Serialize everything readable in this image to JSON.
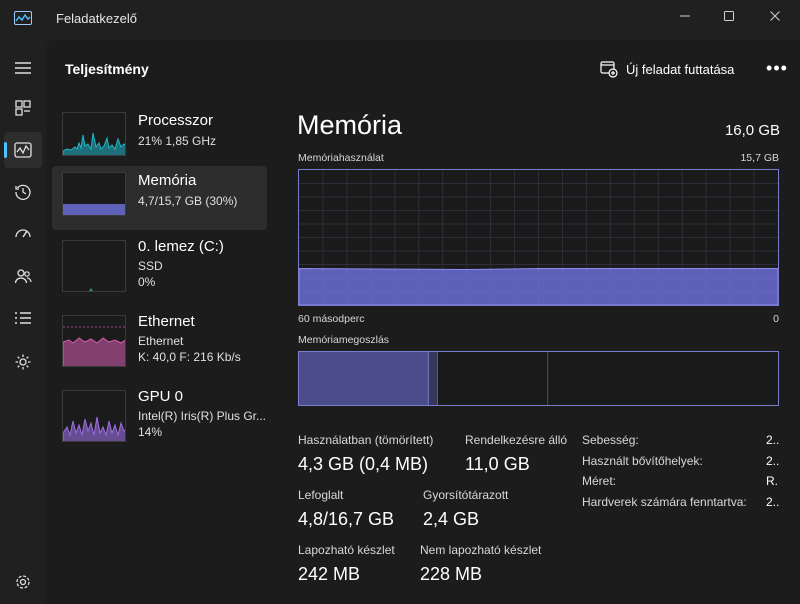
{
  "window": {
    "title": "Feladatkezelő",
    "minimize_glyph": "—",
    "maximize_glyph": "☐",
    "close_glyph": "✕"
  },
  "nav": {
    "items": [
      {
        "icon": "hamburger-menu-icon"
      },
      {
        "icon": "processes-icon"
      },
      {
        "icon": "performance-icon",
        "active": true
      },
      {
        "icon": "app-history-icon"
      },
      {
        "icon": "startup-apps-icon"
      },
      {
        "icon": "users-icon"
      },
      {
        "icon": "details-icon"
      },
      {
        "icon": "services-icon"
      },
      {
        "icon": "settings-icon"
      }
    ]
  },
  "header": {
    "title": "Teljesítmény",
    "run_task_label": "Új feladat futtatása",
    "more_label": "•••"
  },
  "resources": [
    {
      "name": "Processzor",
      "sub1": "21% 1,85 GHz",
      "sub2": "",
      "sub3": "",
      "color": "#1fb7c9"
    },
    {
      "name": "Memória",
      "sub1": "4,7/15,7 GB (30%)",
      "sub2": "",
      "sub3": "",
      "color": "#6c6fd6",
      "selected": true
    },
    {
      "name": "0. lemez (C:)",
      "sub1": "SSD",
      "sub2": "0%",
      "sub3": "",
      "color": "#2fbf71"
    },
    {
      "name": "Ethernet",
      "sub1": "Ethernet",
      "sub2": "K: 40,0 F: 216 Kb/s",
      "sub3": "",
      "color": "#d65fb0"
    },
    {
      "name": "GPU 0",
      "sub1": "Intel(R) Iris(R) Plus Gr...",
      "sub2": "14%",
      "sub3": "",
      "color": "#9a6ee0"
    }
  ],
  "detail": {
    "title": "Memória",
    "total": "16,0 GB",
    "usage_label": "Memóriahasználat",
    "usage_max": "15,7 GB",
    "x_left": "60 másodperc",
    "x_right": "0",
    "usage_level": 0.27,
    "composition_label": "Memóriamegoszlás",
    "composition": {
      "in_use_fraction": 0.27,
      "modified_fraction": 0.02,
      "standby_fraction": 0.23,
      "free_fraction": 0.48
    },
    "stats": [
      {
        "label": "Használatban (tömörített)",
        "value": "4,3 GB (0,4 MB)"
      },
      {
        "label": "Rendelkezésre álló",
        "value": "11,0 GB"
      },
      {
        "label": "Lefoglalt",
        "value": "4,8/16,7 GB"
      },
      {
        "label": "Gyorsítótárazott",
        "value": "2,4 GB"
      },
      {
        "label": "Lapozható készlet",
        "value": "242 MB"
      },
      {
        "label": "Nem lapozható készlet",
        "value": "228 MB"
      }
    ],
    "properties": [
      {
        "key": "Sebesség:",
        "value": "2.."
      },
      {
        "key": "Használt bővítőhelyek:",
        "value": "2.."
      },
      {
        "key": "Méret:",
        "value": "R."
      },
      {
        "key": "Hardverek számára fenntartva:",
        "value": "2.."
      }
    ]
  },
  "colors": {
    "accent": "#4cc2ff",
    "memory": "#6c6fd6",
    "memory_border": "#7a7cd0"
  }
}
